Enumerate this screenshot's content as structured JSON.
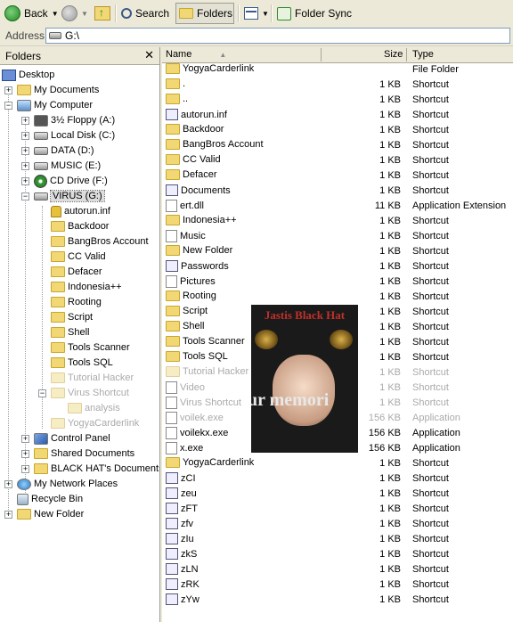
{
  "toolbar": {
    "back": "Back",
    "search": "Search",
    "folders": "Folders",
    "folder_sync": "Folder Sync"
  },
  "address": {
    "label": "Address",
    "value": "G:\\"
  },
  "folders_pane": {
    "title": "Folders",
    "close": "✕",
    "tree": [
      {
        "label": "Desktop"
      },
      {
        "label": "My Documents"
      },
      {
        "label": "My Computer"
      },
      {
        "label": "3½ Floppy (A:)"
      },
      {
        "label": "Local Disk (C:)"
      },
      {
        "label": "DATA (D:)"
      },
      {
        "label": "MUSIC (E:)"
      },
      {
        "label": "CD Drive (F:)"
      },
      {
        "label": "VIRUS (G:)"
      },
      {
        "label": "autorun.inf"
      },
      {
        "label": "Backdoor"
      },
      {
        "label": "BangBros Account"
      },
      {
        "label": "CC Valid"
      },
      {
        "label": "Defacer"
      },
      {
        "label": "Indonesia++"
      },
      {
        "label": "Rooting"
      },
      {
        "label": "Script"
      },
      {
        "label": "Shell"
      },
      {
        "label": "Tools Scanner"
      },
      {
        "label": "Tools SQL"
      },
      {
        "label": "Tutorial Hacker"
      },
      {
        "label": "Virus Shortcut"
      },
      {
        "label": "analysis"
      },
      {
        "label": "YogyaCarderlink"
      },
      {
        "label": "Control Panel"
      },
      {
        "label": "Shared Documents"
      },
      {
        "label": "BLACK HAT's Documents"
      },
      {
        "label": "My Network Places"
      },
      {
        "label": "Recycle Bin"
      },
      {
        "label": "New Folder"
      }
    ]
  },
  "list": {
    "columns": {
      "name": "Name",
      "sort_arrow": "▲",
      "size": "Size",
      "type": "Type"
    },
    "rows": [
      {
        "name": "YogyaCarderlink",
        "size": "",
        "type": "File Folder"
      },
      {
        "name": ".",
        "size": "1 KB",
        "type": "Shortcut"
      },
      {
        "name": "..",
        "size": "1 KB",
        "type": "Shortcut"
      },
      {
        "name": "autorun.inf",
        "size": "1 KB",
        "type": "Shortcut"
      },
      {
        "name": "Backdoor",
        "size": "1 KB",
        "type": "Shortcut"
      },
      {
        "name": "BangBros Account",
        "size": "1 KB",
        "type": "Shortcut"
      },
      {
        "name": "CC Valid",
        "size": "1 KB",
        "type": "Shortcut"
      },
      {
        "name": "Defacer",
        "size": "1 KB",
        "type": "Shortcut"
      },
      {
        "name": "Documents",
        "size": "1 KB",
        "type": "Shortcut"
      },
      {
        "name": "ert.dll",
        "size": "11 KB",
        "type": "Application Extension"
      },
      {
        "name": "Indonesia++",
        "size": "1 KB",
        "type": "Shortcut"
      },
      {
        "name": "Music",
        "size": "1 KB",
        "type": "Shortcut"
      },
      {
        "name": "New Folder",
        "size": "1 KB",
        "type": "Shortcut"
      },
      {
        "name": "Passwords",
        "size": "1 KB",
        "type": "Shortcut"
      },
      {
        "name": "Pictures",
        "size": "1 KB",
        "type": "Shortcut"
      },
      {
        "name": "Rooting",
        "size": "1 KB",
        "type": "Shortcut"
      },
      {
        "name": "Script",
        "size": "1 KB",
        "type": "Shortcut"
      },
      {
        "name": "Shell",
        "size": "1 KB",
        "type": "Shortcut"
      },
      {
        "name": "Tools Scanner",
        "size": "1 KB",
        "type": "Shortcut"
      },
      {
        "name": "Tools SQL",
        "size": "1 KB",
        "type": "Shortcut"
      },
      {
        "name": "Tutorial Hacker",
        "size": "1 KB",
        "type": "Shortcut"
      },
      {
        "name": "Video",
        "size": "1 KB",
        "type": "Shortcut"
      },
      {
        "name": "Virus Shortcut",
        "size": "1 KB",
        "type": "Shortcut"
      },
      {
        "name": "voilek.exe",
        "size": "156 KB",
        "type": "Application"
      },
      {
        "name": "voilekx.exe",
        "size": "156 KB",
        "type": "Application"
      },
      {
        "name": "x.exe",
        "size": "156 KB",
        "type": "Application"
      },
      {
        "name": "YogyaCarderlink",
        "size": "1 KB",
        "type": "Shortcut"
      },
      {
        "name": "zCI",
        "size": "1 KB",
        "type": "Shortcut"
      },
      {
        "name": "zeu",
        "size": "1 KB",
        "type": "Shortcut"
      },
      {
        "name": "zFT",
        "size": "1 KB",
        "type": "Shortcut"
      },
      {
        "name": "zfv",
        "size": "1 KB",
        "type": "Shortcut"
      },
      {
        "name": "zIu",
        "size": "1 KB",
        "type": "Shortcut"
      },
      {
        "name": "zkS",
        "size": "1 KB",
        "type": "Shortcut"
      },
      {
        "name": "zLN",
        "size": "1 KB",
        "type": "Shortcut"
      },
      {
        "name": "zRK",
        "size": "1 KB",
        "type": "Shortcut"
      },
      {
        "name": "zYw",
        "size": "1 KB",
        "type": "Shortcut"
      }
    ]
  },
  "overlay_image": {
    "title": "Jastis Black Hat",
    "caption": "ur memori"
  }
}
